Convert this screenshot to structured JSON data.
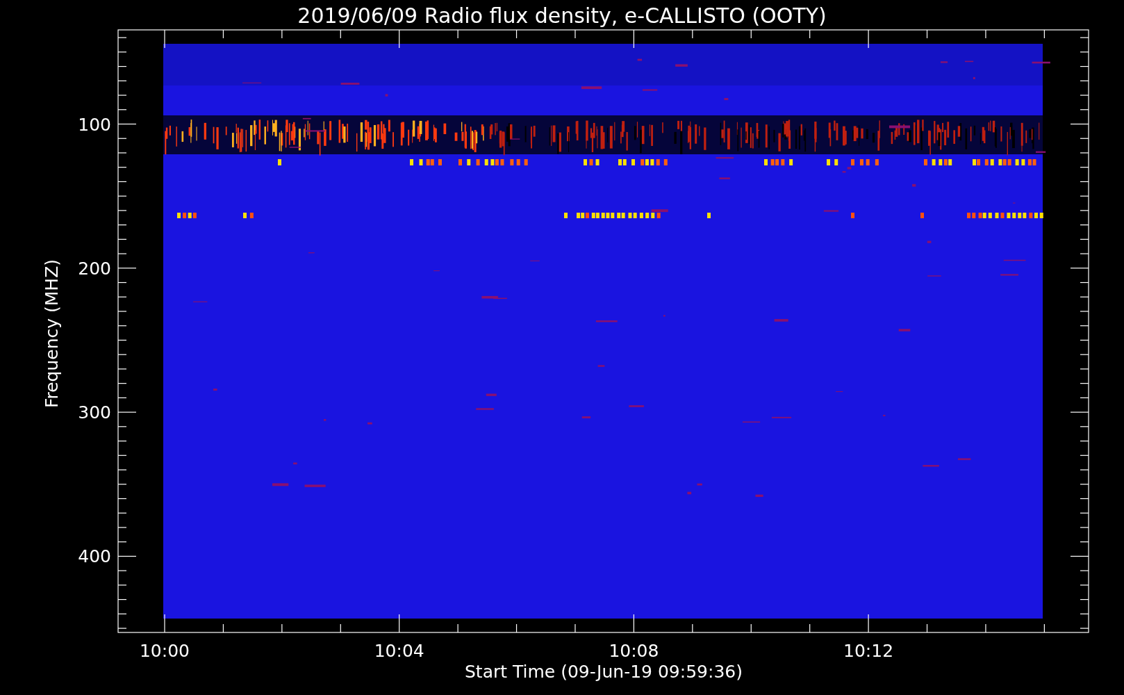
{
  "plot": {
    "title": "2019/06/09  Radio flux density, e-CALLISTO (OOTY)",
    "ylabel": "Frequency (MHZ)",
    "xlabel": "Start Time (09-Jun-19 09:59:36)",
    "yticks": [
      "100",
      "200",
      "300",
      "400"
    ],
    "xticks": [
      "10:00",
      "10:04",
      "10:08",
      "10:12"
    ]
  }
}
